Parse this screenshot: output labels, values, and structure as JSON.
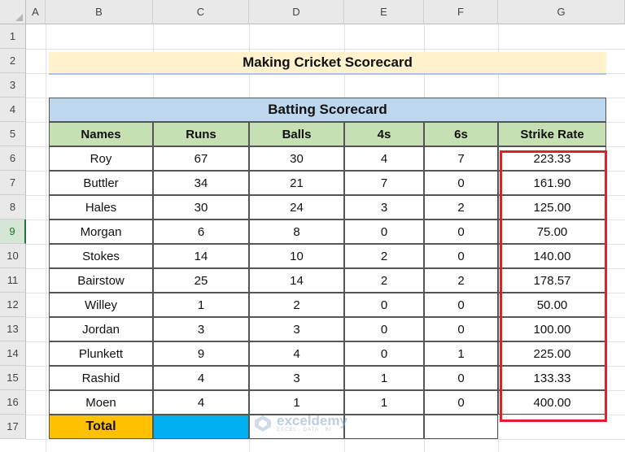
{
  "column_headers": [
    "A",
    "B",
    "C",
    "D",
    "E",
    "F",
    "G"
  ],
  "row_numbers": [
    "1",
    "2",
    "3",
    "4",
    "5",
    "6",
    "7",
    "8",
    "9",
    "10",
    "11",
    "12",
    "13",
    "14",
    "15",
    "16",
    "17"
  ],
  "title": "Making Cricket Scorecard",
  "table": {
    "banner": "Batting Scorecard",
    "headers": [
      "Names",
      "Runs",
      "Balls",
      "4s",
      "6s",
      "Strike Rate"
    ],
    "rows": [
      [
        "Roy",
        "67",
        "30",
        "4",
        "7",
        "223.33"
      ],
      [
        "Buttler",
        "34",
        "21",
        "7",
        "0",
        "161.90"
      ],
      [
        "Hales",
        "30",
        "24",
        "3",
        "2",
        "125.00"
      ],
      [
        "Morgan",
        "6",
        "8",
        "0",
        "0",
        "75.00"
      ],
      [
        "Stokes",
        "14",
        "10",
        "2",
        "0",
        "140.00"
      ],
      [
        "Bairstow",
        "25",
        "14",
        "2",
        "2",
        "178.57"
      ],
      [
        "Willey",
        "1",
        "2",
        "0",
        "0",
        "50.00"
      ],
      [
        "Jordan",
        "3",
        "3",
        "0",
        "0",
        "100.00"
      ],
      [
        "Plunkett",
        "9",
        "4",
        "0",
        "1",
        "225.00"
      ],
      [
        "Rashid",
        "4",
        "3",
        "1",
        "0",
        "133.33"
      ],
      [
        "Moen",
        "4",
        "1",
        "1",
        "0",
        "400.00"
      ]
    ],
    "total_label": "Total"
  },
  "watermark": {
    "name": "exceldemy",
    "tagline": "EXCEL · DATA · BI"
  },
  "colors": {
    "title_fill": "#fff2cc",
    "banner_fill": "#bdd7ee",
    "header_fill": "#c6e0b4",
    "total_fill": "#ffc000",
    "total_blue": "#00b0f0",
    "highlight_border": "#e0202a"
  }
}
